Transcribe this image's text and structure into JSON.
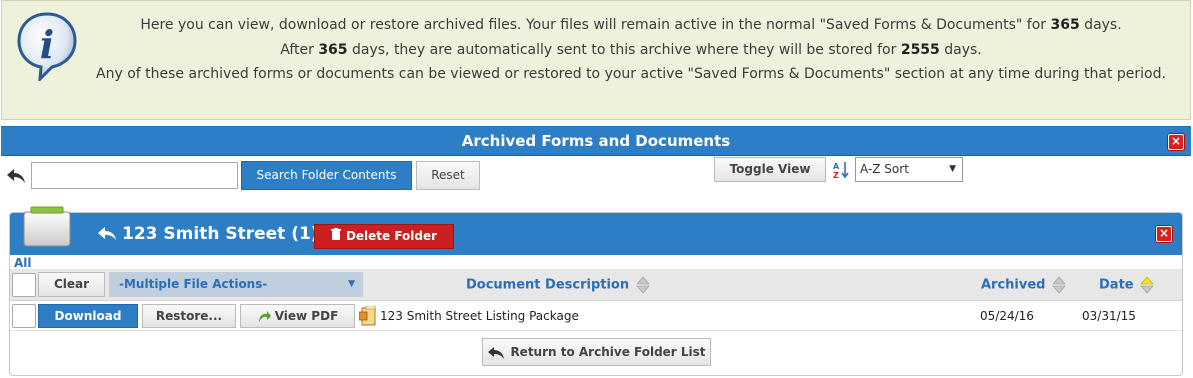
{
  "info": {
    "icon": "info-icon",
    "line1_pre": "Here you can view, download or restore archived files. Your files will remain active in the normal \"Saved Forms & Documents\" for ",
    "active_days": "365",
    "line1_post": " days.",
    "line2_pre": "After ",
    "line2_days": "365",
    "line2_mid": " days, they are automatically sent to this archive where they will be stored for ",
    "archive_days": "2555",
    "line2_post": " days.",
    "line3": "Any of these archived forms or documents can be viewed or restored to your active \"Saved Forms & Documents\" section at any time during that period."
  },
  "archive": {
    "title": "Archived Forms and Documents",
    "close_label": "×"
  },
  "search": {
    "value": "",
    "placeholder": "",
    "search_button": "Search Folder Contents",
    "reset_button": "Reset",
    "toggle_view": "Toggle View",
    "sort_selected": "A-Z Sort"
  },
  "folder": {
    "title": "123 Smith Street (1)",
    "delete_button": "Delete Folder",
    "close_label": "×"
  },
  "list": {
    "all_link": "All",
    "clear_button": "Clear",
    "multi_action_selected": "-Multiple File Actions-",
    "columns": {
      "description": "Document Description",
      "archived": "Archived",
      "date": "Date"
    },
    "rows": [
      {
        "download": "Download",
        "restore": "Restore...",
        "view_pdf": "View PDF",
        "description": "123 Smith Street Listing Package",
        "archived": "05/24/16",
        "date": "03/31/15"
      }
    ],
    "return_button": "Return to Archive Folder List"
  },
  "colors": {
    "banner_bg": "#eef1dc",
    "header_blue": "#2d7ec4",
    "link_blue": "#2a6fba",
    "danger_red": "#cc1f1f"
  }
}
